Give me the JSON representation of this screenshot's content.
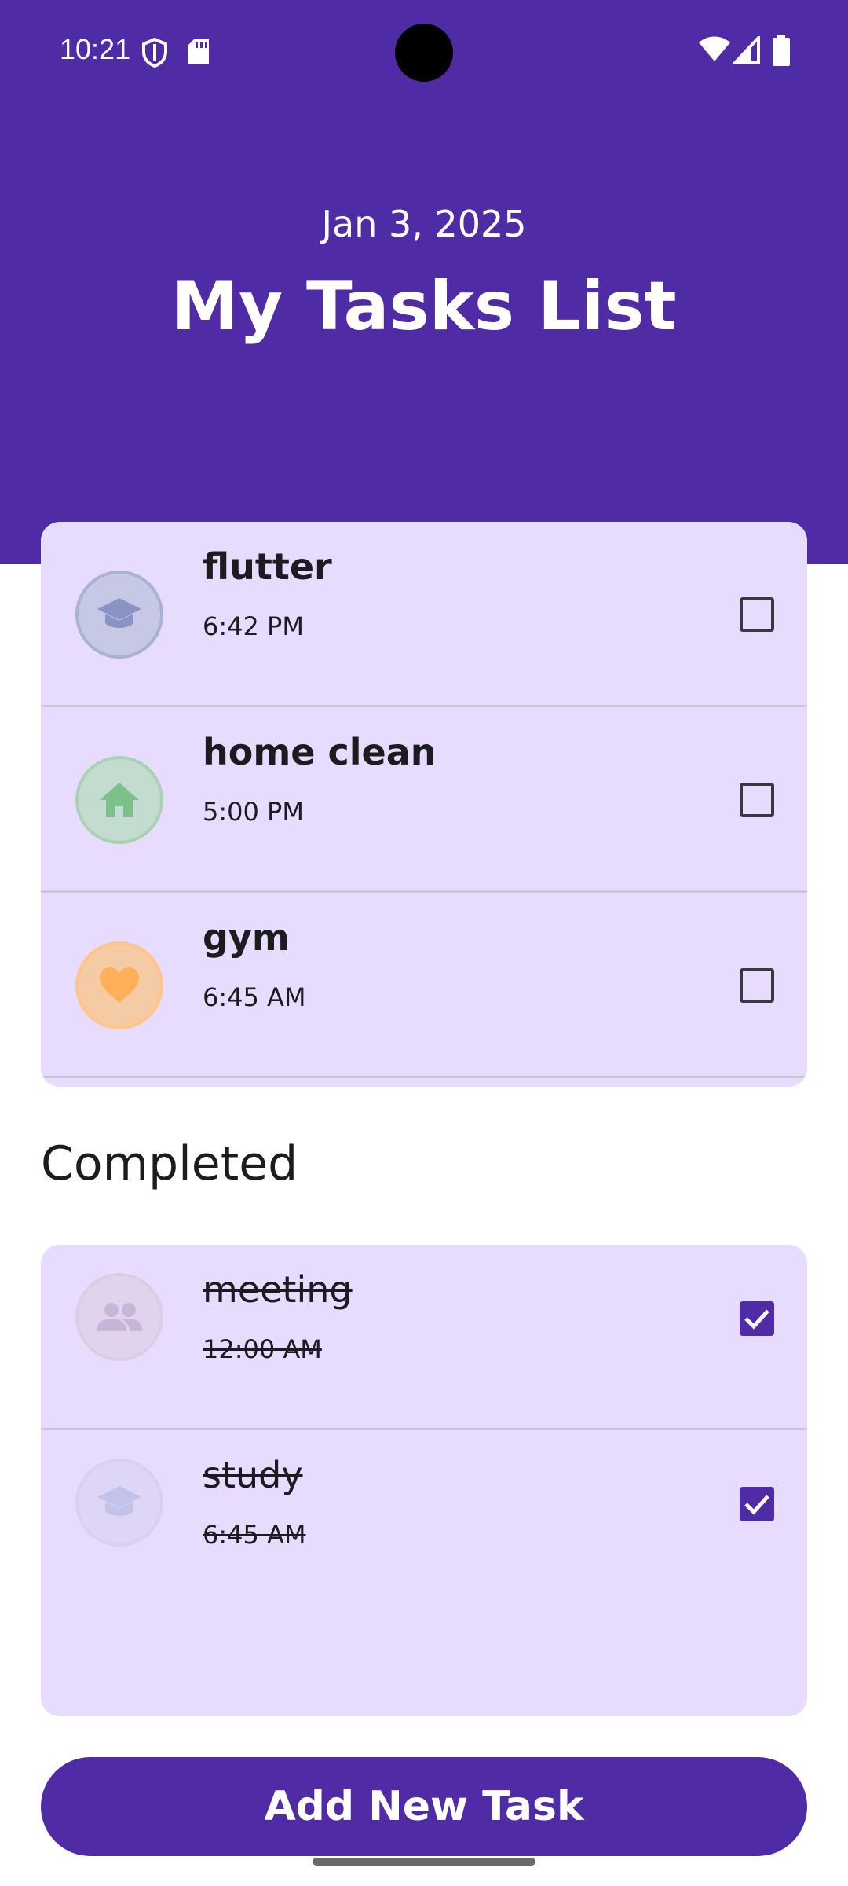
{
  "status": {
    "time": "10:21",
    "icons": [
      "shield-icon",
      "sd-card-icon",
      "wifi-icon",
      "signal-icon",
      "battery-icon"
    ]
  },
  "header": {
    "date": "Jan 3, 2025",
    "title": "My Tasks List",
    "color": "#4f2ca6"
  },
  "todo_tasks": [
    {
      "name": "flutter",
      "time": "6:42 PM",
      "icon": "graduation-cap-icon",
      "color": "#9aa6d6"
    },
    {
      "name": "home clean",
      "time": "5:00 PM",
      "icon": "house-icon",
      "color": "#7cc08a"
    },
    {
      "name": "gym",
      "time": "6:45 AM",
      "icon": "heart-icon",
      "color": "#ffb058"
    }
  ],
  "completed_section": {
    "title": "Completed"
  },
  "completed_tasks": [
    {
      "name": "meeting",
      "time": "12:00 AM",
      "icon": "people-icon",
      "color": "#c7b6d8"
    },
    {
      "name": "study",
      "time": "6:45 AM",
      "icon": "graduation-cap-icon",
      "color": "#c3c2ea"
    }
  ],
  "add_button": {
    "label": "Add New Task"
  }
}
